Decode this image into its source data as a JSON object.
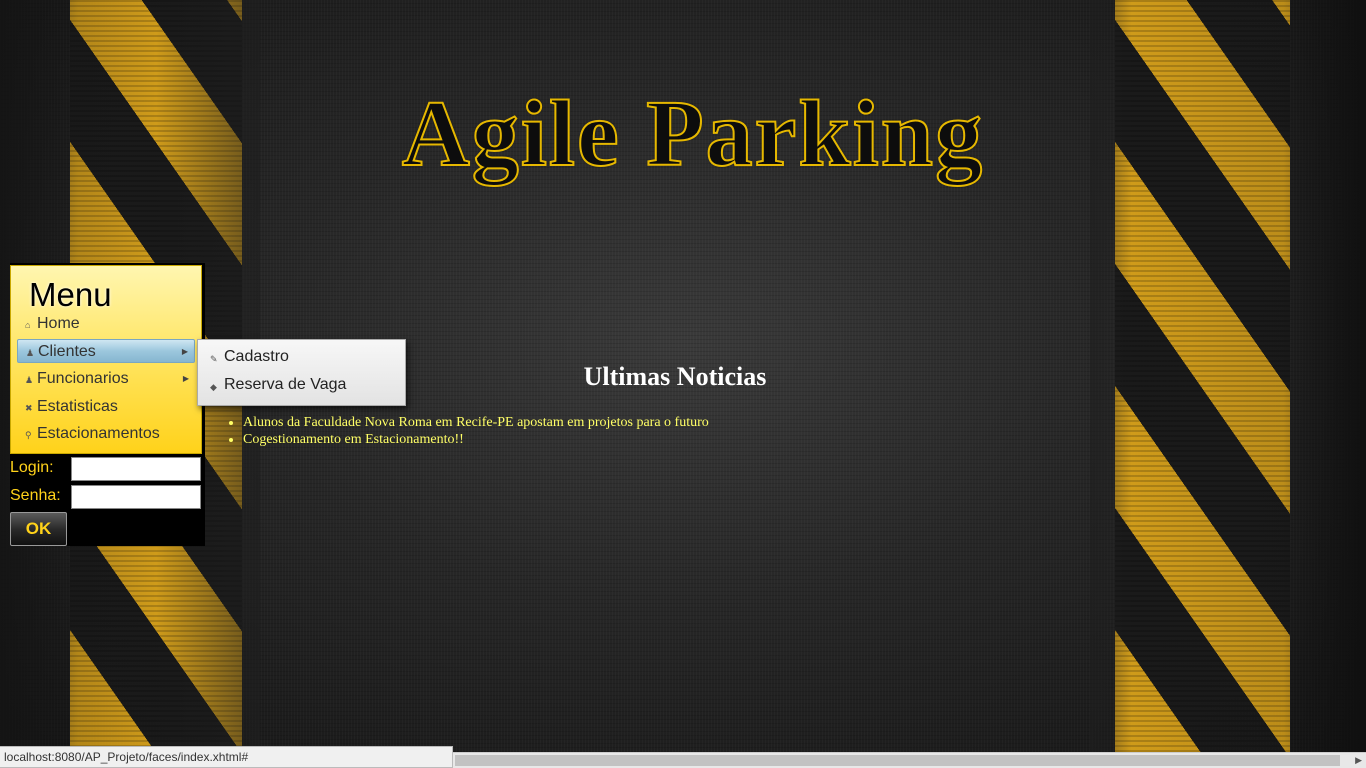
{
  "app": {
    "title": "Agile Parking"
  },
  "menu": {
    "heading": "Menu",
    "items": [
      {
        "label": "Home",
        "icon": "home-icon"
      },
      {
        "label": "Clientes",
        "icon": "user-icon",
        "has_submenu": true,
        "active": true
      },
      {
        "label": "Funcionarios",
        "icon": "user-icon",
        "has_submenu": true
      },
      {
        "label": "Estatisticas",
        "icon": "close-icon"
      },
      {
        "label": "Estacionamentos",
        "icon": "search-icon"
      }
    ],
    "submenu": [
      {
        "label": "Cadastro",
        "icon": "pencil-icon"
      },
      {
        "label": "Reserva de Vaga",
        "icon": "tag-icon"
      }
    ]
  },
  "login": {
    "login_label": "Login:",
    "senha_label": "Senha:",
    "login_value": "",
    "senha_value": "",
    "ok_label": "OK"
  },
  "news": {
    "title": "Ultimas Noticias",
    "items": [
      "Alunos da Faculdade Nova Roma em Recife-PE apostam em projetos para o futuro",
      "Cogestionamento em Estacionamento!!"
    ]
  },
  "statusbar": {
    "url": "localhost:8080/AP_Projeto/faces/index.xhtml#"
  },
  "colors": {
    "accent": "#ffd21a",
    "news_text": "#ffff66",
    "title_outline": "#e6b800"
  }
}
